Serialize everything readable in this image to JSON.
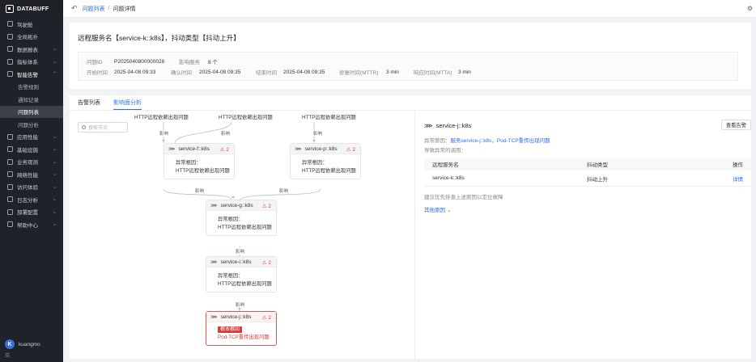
{
  "app": {
    "logo": "DATABUFF",
    "user": "kuangmo",
    "user_initial": "K"
  },
  "sidebar": {
    "items": [
      {
        "label": "驾驶舱",
        "open": false
      },
      {
        "label": "全局拓扑",
        "open": false
      },
      {
        "label": "数据报表",
        "open": false,
        "chevron": true
      },
      {
        "label": "指标体系",
        "open": false,
        "chevron": true
      },
      {
        "label": "智能告警",
        "open": true,
        "chevron": true
      }
    ],
    "sub_items": [
      {
        "label": "告警规则",
        "active": false
      },
      {
        "label": "通知记录",
        "active": false
      },
      {
        "label": "问题列表",
        "active": true
      },
      {
        "label": "问题分析",
        "active": false
      }
    ],
    "items_after": [
      {
        "label": "应用性能",
        "chevron": true
      },
      {
        "label": "基础设施",
        "chevron": true
      },
      {
        "label": "业务观测",
        "chevron": true
      },
      {
        "label": "网络性能",
        "chevron": true
      },
      {
        "label": "访问体验",
        "chevron": true
      },
      {
        "label": "日志分析",
        "chevron": true
      },
      {
        "label": "部署配置",
        "chevron": true
      },
      {
        "label": "帮助中心",
        "chevron": true
      }
    ]
  },
  "breadcrumb": {
    "parent": "问题列表",
    "separator": "/",
    "current": "问题详情"
  },
  "problem": {
    "title": "远程服务名【service-k::k8s】，抖动类型【抖动上升】",
    "id_label": "问题ID",
    "id": "P2025040800000028",
    "affected_label": "影响服务",
    "affected": "8 个",
    "start_label": "开始时间",
    "start": "2025-04-08 09:33",
    "confirm_label": "确认时间",
    "confirm": "2025-04-08 09:35",
    "end_label": "结束时间",
    "end": "2025-04-08 09:35",
    "mttr_label": "修复时间(MTTR)",
    "mttr": "3 min",
    "mtta_label": "响应时间(MTTA)",
    "mtta": "3 min"
  },
  "tabs": [
    {
      "label": "告警列表",
      "active": false
    },
    {
      "label": "影响面分析",
      "active": true
    }
  ],
  "search": {
    "placeholder": "搜索节点"
  },
  "graph": {
    "edge_label": "影响",
    "top_fragments": [
      "HTTP远程依赖出现问题",
      "HTTP远程依赖出现问题",
      "HTTP远程依赖出现问题"
    ],
    "nodes": {
      "f": {
        "name": "service-f::k8s",
        "count": "2",
        "cause_label": "异常根因：",
        "cause": "HTTP远程依赖出现问题"
      },
      "p": {
        "name": "service-p::k8s",
        "count": "2",
        "cause_label": "异常根因：",
        "cause": "HTTP远程依赖出现问题"
      },
      "g": {
        "name": "service-g::k8s",
        "count": "2",
        "cause_label": "异常根因：",
        "cause": "HTTP远程依赖出现问题"
      },
      "i": {
        "name": "service-i::k8s",
        "count": "2",
        "cause_label": "异常根因：",
        "cause": "HTTP远程依赖出现问题"
      },
      "j": {
        "name": "service-j::k8s",
        "count": "2",
        "badge": "根本根因",
        "cause": "Pod-TCP重传出现问题"
      }
    }
  },
  "detail": {
    "service": "service-j::k8s",
    "button": "查看告警",
    "cause_label": "异常原因：",
    "cause_link": "服务service-j::k8s，Pod-TCP重传出现问题",
    "sub": "导致异常的调用：",
    "table": {
      "headers": [
        "远程服务名",
        "抖动类型",
        "操作"
      ],
      "rows": [
        {
          "service": "service-k::k8s",
          "type": "抖动上升",
          "action": "详情"
        }
      ]
    },
    "note": "建议优先排查上述原因以定位故障",
    "more": "其他原因"
  },
  "colors": {
    "accent": "#2f6bff",
    "danger": "#d93a3a",
    "sidebar": "#1f2229"
  }
}
